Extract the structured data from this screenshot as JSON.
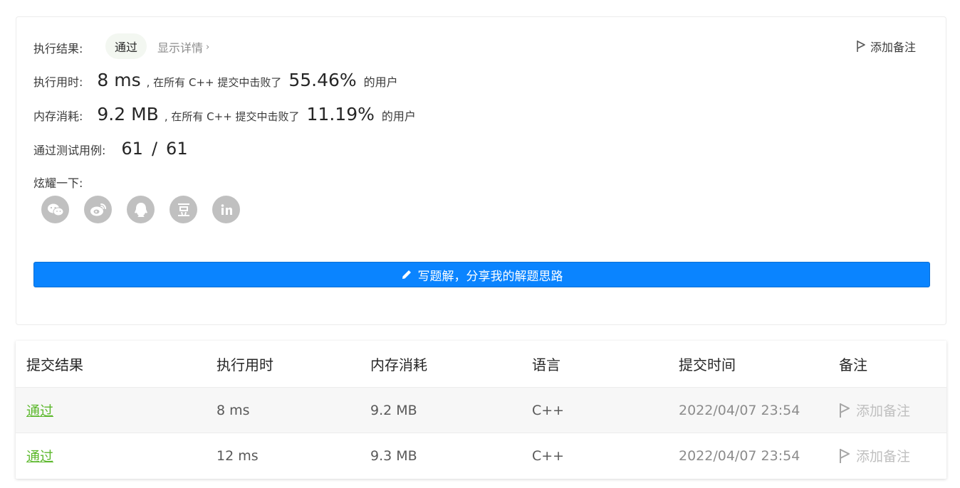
{
  "result": {
    "label": "执行结果:",
    "status": "通过",
    "details_link": "显示详情",
    "add_note": "添加备注"
  },
  "runtime": {
    "label": "执行用时:",
    "value": "8 ms",
    "mid_text": ", 在所有 C++ 提交中击败了",
    "percent": "55.46%",
    "suffix": "的用户"
  },
  "memory": {
    "label": "内存消耗:",
    "value": "9.2 MB",
    "mid_text": ", 在所有 C++ 提交中击败了",
    "percent": "11.19%",
    "suffix": "的用户"
  },
  "testcases": {
    "label": "通过测试用例:",
    "passed": "61",
    "separator": "/",
    "total": "61"
  },
  "share": {
    "label": "炫耀一下:",
    "icons": [
      "wechat-icon",
      "weibo-icon",
      "qq-icon",
      "douban-icon",
      "linkedin-icon"
    ],
    "icon_color": "#c0c0c0"
  },
  "solution_button": {
    "label": "写题解，分享我的解题思路",
    "color": "#0a84ff"
  },
  "submissions": {
    "headers": [
      "提交结果",
      "执行用时",
      "内存消耗",
      "语言",
      "提交时间",
      "备注"
    ],
    "rows": [
      {
        "status": "通过",
        "runtime": "8 ms",
        "memory": "9.2 MB",
        "lang": "C++",
        "time": "2022/04/07 23:54",
        "note": "添加备注"
      },
      {
        "status": "通过",
        "runtime": "12 ms",
        "memory": "9.3 MB",
        "lang": "C++",
        "time": "2022/04/07 23:54",
        "note": "添加备注"
      }
    ],
    "status_color": "#5cb82c"
  }
}
